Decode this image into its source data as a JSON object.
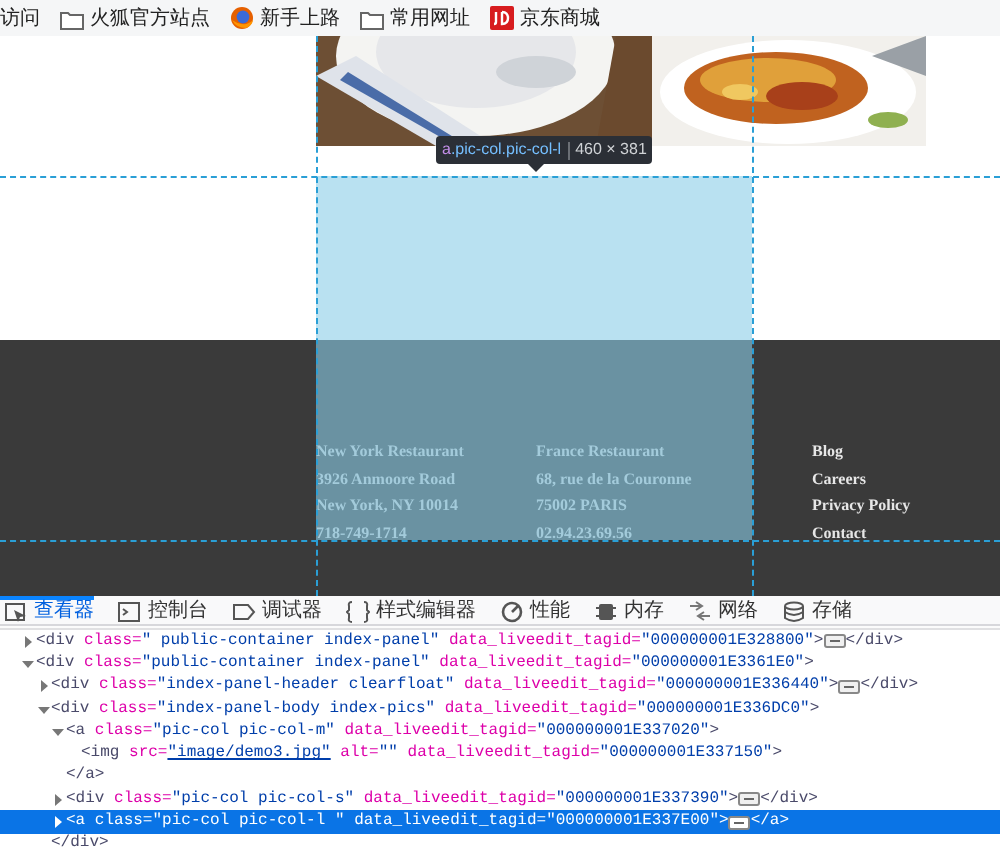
{
  "bookmarks": [
    {
      "label": "访问",
      "kind": "plain"
    },
    {
      "label": "火狐官方站点",
      "kind": "folder"
    },
    {
      "label": "新手上路",
      "kind": "browser"
    },
    {
      "label": "常用网址",
      "kind": "folder"
    },
    {
      "label": "京东商城",
      "kind": "store"
    }
  ],
  "page": {
    "highlight": {
      "tag": "a",
      "selector": ".pic-col.pic-col-l",
      "size": "460 × 381"
    },
    "footer": {
      "columns": [
        {
          "kind": "address",
          "lines": [
            "New York Restaurant",
            "3926 Anmoore Road",
            "New York, NY 10014",
            "718-749-1714"
          ]
        },
        {
          "kind": "address",
          "lines": [
            "France Restaurant",
            "68, rue de la Couronne",
            "75002 PARIS",
            "02.94.23.69.56"
          ]
        },
        {
          "kind": "links",
          "lines": [
            "Blog",
            "Careers",
            "Privacy Policy",
            "Contact"
          ]
        }
      ]
    }
  },
  "devtools": {
    "tabs": [
      {
        "label": "查看器",
        "kind": "inspector",
        "selected": true
      },
      {
        "label": "控制台",
        "kind": "console",
        "selected": false
      },
      {
        "label": "调试器",
        "kind": "debugger",
        "selected": false
      },
      {
        "label": "样式编辑器",
        "kind": "style",
        "selected": false
      },
      {
        "label": "性能",
        "kind": "performance",
        "selected": false
      },
      {
        "label": "内存",
        "kind": "memory",
        "selected": false
      },
      {
        "label": "网络",
        "kind": "network",
        "selected": false
      },
      {
        "label": "存储",
        "kind": "storage",
        "selected": false
      }
    ],
    "tree": [
      {
        "open": "<div",
        "attributes": [
          {
            "name": "class=",
            "value": "\" public-container index-panel\""
          },
          {
            "name": "data_liveedit_tagid=",
            "value": "\"000000001E328800\""
          }
        ],
        "end": ">",
        "expanded": false,
        "selected": false,
        "close": "</div>"
      },
      {
        "open": "<div",
        "attributes": [
          {
            "name": "class=",
            "value": "\"public-container index-panel\""
          },
          {
            "name": "data_liveedit_tagid=",
            "value": "\"000000001E3361E0\""
          }
        ],
        "end": ">",
        "expanded": true,
        "selected": false,
        "children": [
          {
            "open": "<div",
            "attributes": [
              {
                "name": "class=",
                "value": "\"index-panel-header clearfloat\""
              },
              {
                "name": "data_liveedit_tagid=",
                "value": "\"000000001E336440\""
              }
            ],
            "end": ">",
            "expanded": false,
            "selected": false,
            "close": "</div>"
          },
          {
            "open": "<div",
            "attributes": [
              {
                "name": "class=",
                "value": "\"index-panel-body index-pics\""
              },
              {
                "name": "data_liveedit_tagid=",
                "value": "\"000000001E336DC0\""
              }
            ],
            "end": ">",
            "expanded": true,
            "selected": false,
            "close": "</div>",
            "children": [
              {
                "open": "<a",
                "attributes": [
                  {
                    "name": "class=",
                    "value": "\"pic-col pic-col-m\""
                  },
                  {
                    "name": "data_liveedit_tagid=",
                    "value": "\"000000001E337020\""
                  }
                ],
                "end": ">",
                "expanded": true,
                "selected": false,
                "close": "</a>",
                "children": [
                  {
                    "open": "<img",
                    "attributes": [
                      {
                        "name": "src=",
                        "value": "\"image/demo3.jpg\"",
                        "kind": "link"
                      },
                      {
                        "name": "alt=",
                        "value": "\"\""
                      },
                      {
                        "name": "data_liveedit_tagid=",
                        "value": "\"000000001E337150\""
                      }
                    ],
                    "end": ">",
                    "selected": false
                  }
                ]
              },
              {
                "open": "<div",
                "attributes": [
                  {
                    "name": "class=",
                    "value": "\"pic-col pic-col-s\""
                  },
                  {
                    "name": "data_liveedit_tagid=",
                    "value": "\"000000001E337390\""
                  }
                ],
                "end": ">",
                "expanded": false,
                "selected": false,
                "close": "</div>"
              },
              {
                "open": "<a",
                "attributes": [
                  {
                    "name": "class=",
                    "value": "\"pic-col pic-col-l \""
                  },
                  {
                    "name": "data_liveedit_tagid=",
                    "value": "\"000000001E337E00\""
                  }
                ],
                "end": ">",
                "expanded": false,
                "selected": true,
                "close": "</a>"
              }
            ]
          }
        ]
      }
    ]
  }
}
